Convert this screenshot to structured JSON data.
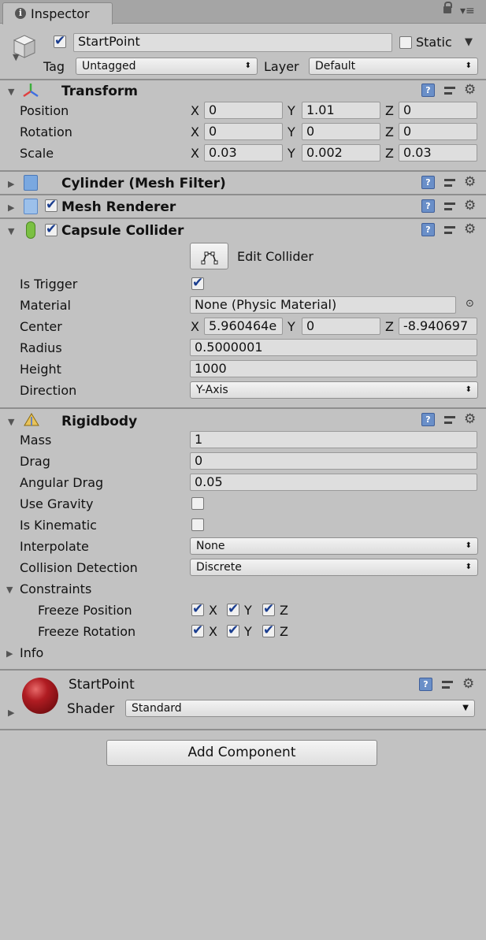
{
  "tab": {
    "title": "Inspector"
  },
  "header": {
    "name": "StartPoint",
    "static_label": "Static",
    "tag_label": "Tag",
    "tag_value": "Untagged",
    "layer_label": "Layer",
    "layer_value": "Default",
    "active": true,
    "static": false
  },
  "transform": {
    "title": "Transform",
    "rows": [
      {
        "label": "Position",
        "x": "0",
        "y": "1.01",
        "z": "0"
      },
      {
        "label": "Rotation",
        "x": "0",
        "y": "0",
        "z": "0"
      },
      {
        "label": "Scale",
        "x": "0.03",
        "y": "0.002",
        "z": "0.03"
      }
    ]
  },
  "axes": {
    "x": "X",
    "y": "Y",
    "z": "Z"
  },
  "mesh_filter": {
    "title": "Cylinder (Mesh Filter)"
  },
  "mesh_renderer": {
    "title": "Mesh Renderer",
    "enabled": true
  },
  "capsule": {
    "title": "Capsule Collider",
    "enabled": true,
    "edit_collider": "Edit Collider",
    "is_trigger_label": "Is Trigger",
    "is_trigger": true,
    "material_label": "Material",
    "material": "None (Physic Material)",
    "center_label": "Center",
    "center_x": "5.960464e",
    "center_y": "0",
    "center_z": "-8.940697",
    "radius_label": "Radius",
    "radius": "0.5000001",
    "height_label": "Height",
    "height": "1000",
    "direction_label": "Direction",
    "direction": "Y-Axis"
  },
  "rigidbody": {
    "title": "Rigidbody",
    "mass_label": "Mass",
    "mass": "1",
    "drag_label": "Drag",
    "drag": "0",
    "angular_drag_label": "Angular Drag",
    "angular_drag": "0.05",
    "use_gravity_label": "Use Gravity",
    "use_gravity": false,
    "is_kinematic_label": "Is Kinematic",
    "is_kinematic": false,
    "interpolate_label": "Interpolate",
    "interpolate": "None",
    "collision_label": "Collision Detection",
    "collision": "Discrete",
    "constraints_label": "Constraints",
    "freeze_position_label": "Freeze Position",
    "freeze_rotation_label": "Freeze Rotation",
    "info_label": "Info"
  },
  "material": {
    "name": "StartPoint",
    "shader_label": "Shader",
    "shader": "Standard",
    "color": "#b01c22"
  },
  "add_component": "Add Component"
}
